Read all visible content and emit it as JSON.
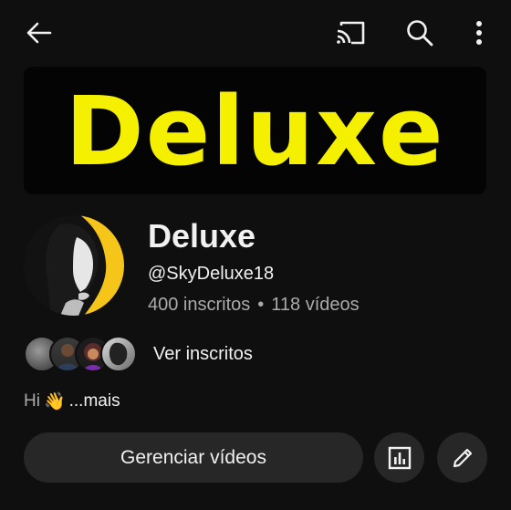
{
  "header": {
    "back_icon": "arrow-left-icon",
    "cast_icon": "cast-icon",
    "search_icon": "search-icon",
    "more_icon": "more-vertical-icon"
  },
  "banner": {
    "text": "Deluxe",
    "text_color": "#f5ef00",
    "background": "#040404"
  },
  "channel": {
    "name": "Deluxe",
    "handle": "@SkyDeluxe18",
    "subscribers": "400 inscritos",
    "separator": "•",
    "videos": "118 vídeos"
  },
  "subscribers_preview": {
    "label": "Ver inscritos",
    "avatar_count": 4
  },
  "description": {
    "text": "Hi",
    "emoji": "👋",
    "more": "...mais"
  },
  "actions": {
    "manage_label": "Gerenciar vídeos",
    "analytics_icon": "analytics-icon",
    "edit_icon": "pencil-icon"
  },
  "colors": {
    "background": "#0f0f0f",
    "button_bg": "#272727",
    "text_primary": "#f1f1f1",
    "text_secondary": "#aaaaaa"
  }
}
